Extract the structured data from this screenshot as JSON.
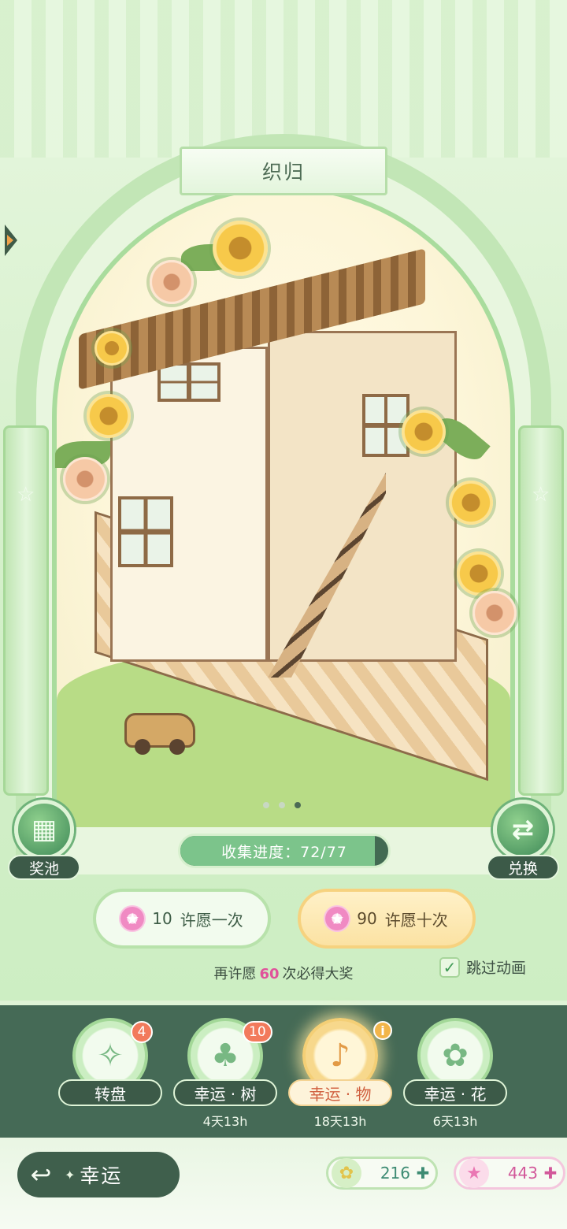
{
  "title": "织归",
  "progress": {
    "label": "收集进度：72/77",
    "collected": 72,
    "total": 77
  },
  "side_buttons": {
    "pool": "奖池",
    "exchange": "兑换"
  },
  "carousel": {
    "count": 3,
    "active": 3
  },
  "wish": {
    "single": {
      "cost": "10",
      "label": "许愿一次"
    },
    "ten": {
      "cost": "90",
      "label": "许愿十次"
    }
  },
  "guarantee": {
    "prefix": "再许愿",
    "count": "60",
    "suffix": "次必得大奖"
  },
  "skip_animation": {
    "label": "跳过动画",
    "checked": true
  },
  "tabs": [
    {
      "label": "转盘",
      "badge": "4",
      "timer": "",
      "icon": "compass-icon"
    },
    {
      "label": "幸运 · 树",
      "badge": "10",
      "timer": "4天13h",
      "icon": "tree-icon"
    },
    {
      "label": "幸运 · 物",
      "badge": "",
      "timer": "18天13h",
      "icon": "microphone-icon",
      "active": true
    },
    {
      "label": "幸运 · 花",
      "badge": "",
      "timer": "6天13h",
      "icon": "flower-icon"
    }
  ],
  "footer": {
    "back_label": "幸运",
    "currency_green": "216",
    "currency_pink": "443"
  },
  "colors": {
    "accent_dark": "#456a56",
    "accent_light": "#dff3d6",
    "highlight_pink": "#e0529a",
    "badge_orange": "#f27a5c"
  }
}
